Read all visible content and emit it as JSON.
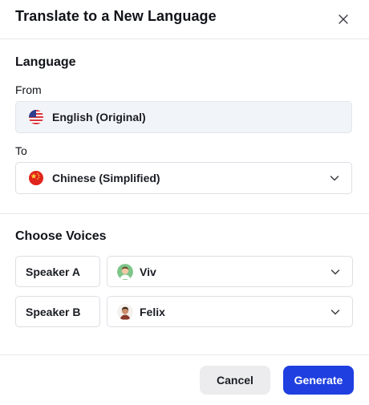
{
  "dialog": {
    "title": "Translate to a New Language",
    "close_icon": "close-icon"
  },
  "language_section": {
    "title": "Language",
    "from_label": "From",
    "from_value": "English (Original)",
    "from_flag": "us-flag-icon",
    "to_label": "To",
    "to_value": "Chinese (Simplified)",
    "to_flag": "china-flag-icon"
  },
  "voices_section": {
    "title": "Choose Voices",
    "speakers": [
      {
        "label": "Speaker A",
        "voice": "Viv",
        "avatar": "viv-avatar"
      },
      {
        "label": "Speaker B",
        "voice": "Felix",
        "avatar": "felix-avatar"
      }
    ]
  },
  "footer": {
    "cancel_label": "Cancel",
    "generate_label": "Generate"
  },
  "colors": {
    "primary": "#1f3fe0",
    "secondary_button": "#ececee",
    "readonly_field": "#f1f4f8",
    "border": "#dcdfe4"
  }
}
